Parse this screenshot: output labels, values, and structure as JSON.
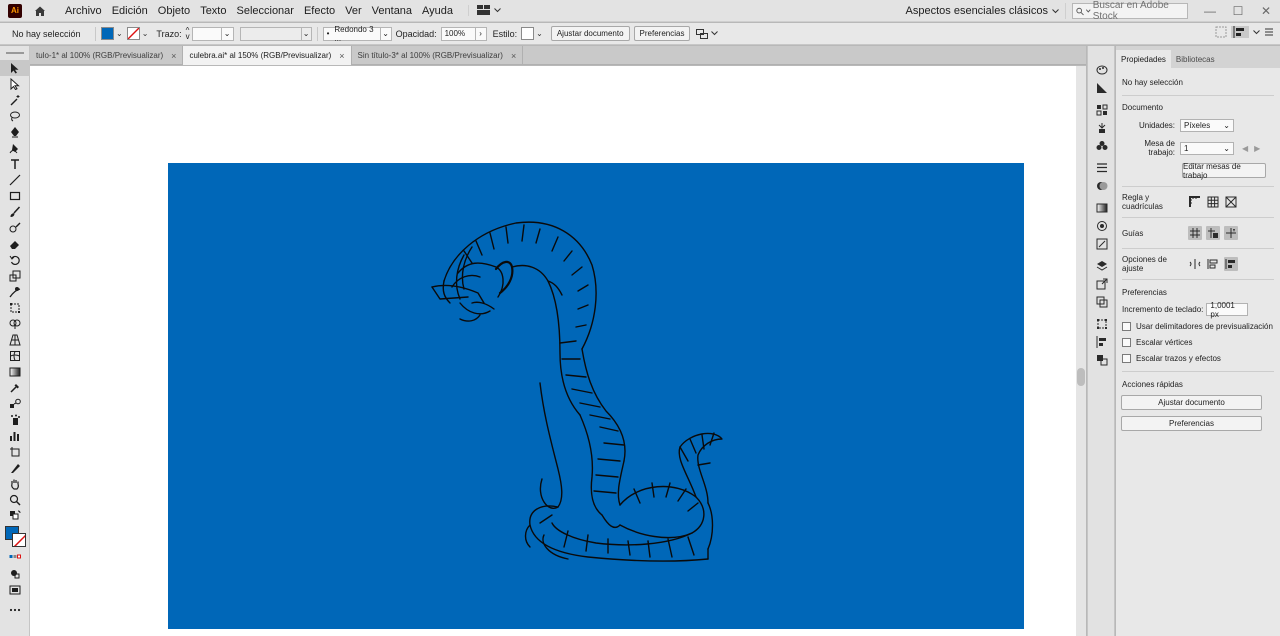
{
  "app": {
    "logo_text": "Ai"
  },
  "menu": [
    "Archivo",
    "Edición",
    "Objeto",
    "Texto",
    "Seleccionar",
    "Efecto",
    "Ver",
    "Ventana",
    "Ayuda"
  ],
  "workspace": "Aspectos esenciales clásicos",
  "stock_search": {
    "placeholder": "Buscar en Adobe Stock"
  },
  "control": {
    "selection": "No hay selección",
    "fill_color": "#0067b8",
    "stroke_label": "Trazo:",
    "brush_value": "Redondo 3 ...",
    "opacity_label": "Opacidad:",
    "opacity_value": "100%",
    "style_label": "Estilo:",
    "adjust_button": "Ajustar documento",
    "prefs_button": "Preferencias"
  },
  "tabs": [
    {
      "label": "tulo-1* al 100% (RGB/Previsualizar)",
      "active": false
    },
    {
      "label": "culebra.ai* al 150% (RGB/Previsualizar)",
      "active": true
    },
    {
      "label": "Sin título-3* al 100% (RGB/Previsualizar)",
      "active": false
    }
  ],
  "icons": {
    "toolbar": [
      "selection-tool-icon",
      "direct-selection-tool-icon",
      "magic-wand-tool-icon",
      "lasso-tool-icon",
      "pen-tool-icon",
      "curvature-tool-icon",
      "type-tool-icon",
      "line-tool-icon",
      "rectangle-tool-icon",
      "paintbrush-tool-icon",
      "blob-brush-tool-icon",
      "eraser-tool-icon",
      "rotate-tool-icon",
      "scale-tool-icon",
      "warp-tool-icon",
      "free-transform-tool-icon",
      "shape-builder-tool-icon",
      "perspective-grid-tool-icon",
      "mesh-tool-icon",
      "gradient-tool-icon",
      "eyedropper-tool-icon",
      "blend-tool-icon",
      "symbol-sprayer-tool-icon",
      "graph-tool-icon",
      "artboard-tool-icon",
      "slice-tool-icon",
      "hand-tool-icon",
      "zoom-tool-icon"
    ]
  },
  "artboard": {
    "background": "#0067b8",
    "stroke": "#0a0a0a"
  },
  "panel": {
    "tab_properties": "Propiedades",
    "tab_libraries": "Bibliotecas",
    "no_selection": "No hay selección",
    "document_title": "Documento",
    "units_label": "Unidades:",
    "units_value": "Píxeles",
    "artboard_label": "Mesa de trabajo:",
    "artboard_value": "1",
    "edit_artboards_button": "Editar mesas de trabajo",
    "rulers_label": "Regla y cuadrículas",
    "guides_label": "Guías",
    "snap_label": "Opciones de ajuste",
    "prefs_title": "Preferencias",
    "keyboard_increment_label": "Incremento de teclado:",
    "keyboard_increment_value": "1,0001 px",
    "check_preview_bounds": "Usar delimitadores de previsualización",
    "check_scale_corners": "Escalar vértices",
    "check_scale_strokes": "Escalar trazos y efectos",
    "quick_actions_title": "Acciones rápidas",
    "quick_adjust_button": "Ajustar documento",
    "quick_prefs_button": "Preferencias"
  }
}
